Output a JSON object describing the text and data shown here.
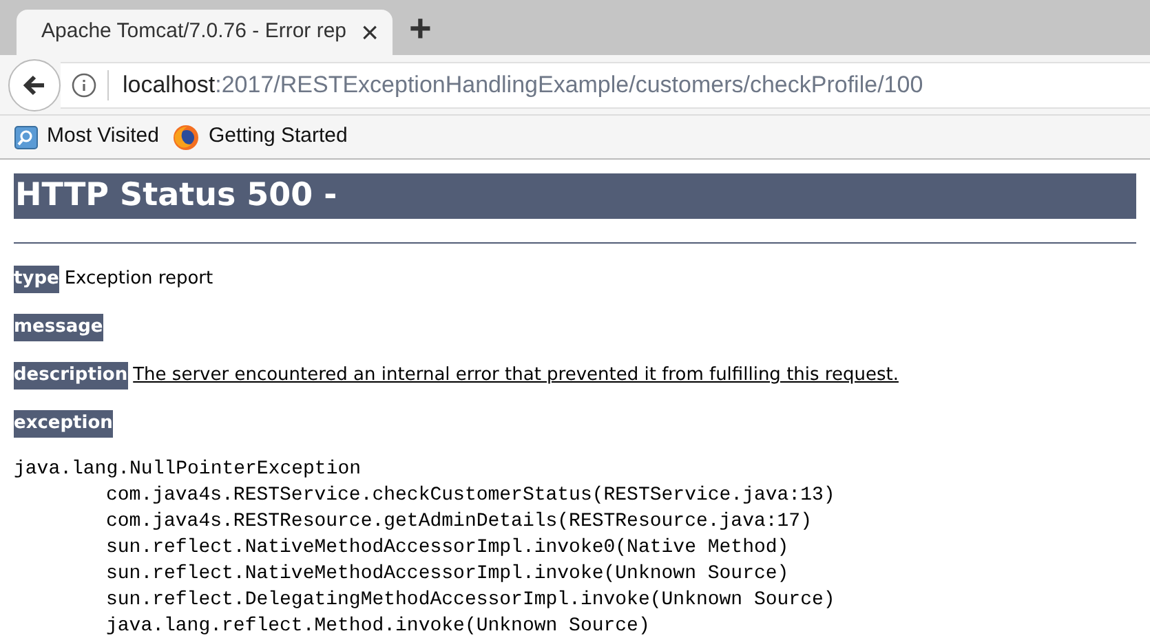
{
  "tab": {
    "title": "Apache Tomcat/7.0.76 - Error rep",
    "close": "×"
  },
  "new_tab": "+",
  "address": {
    "host": "localhost",
    "path": ":2017/RESTExceptionHandlingExample/customers/checkProfile/100"
  },
  "bookmarks": [
    {
      "label": "Most Visited",
      "kind": "folder"
    },
    {
      "label": "Getting Started",
      "kind": "browser"
    }
  ],
  "page": {
    "heading": "HTTP Status 500 -",
    "fields": [
      {
        "label": "type",
        "value": "Exception report",
        "underlined": false
      },
      {
        "label": "message"
      },
      {
        "label": "description",
        "value": "The server encountered an internal error that prevented it from fulfilling this request.",
        "underlined": true
      },
      {
        "label": "exception"
      }
    ],
    "exception": {
      "name": "java.lang.NullPointerException",
      "frames": [
        "com.java4s.RESTService.checkCustomerStatus(RESTService.java:13)",
        "com.java4s.RESTResource.getAdminDetails(RESTResource.java:17)",
        "sun.reflect.NativeMethodAccessorImpl.invoke0(Native Method)",
        "sun.reflect.NativeMethodAccessorImpl.invoke(Unknown Source)",
        "sun.reflect.DelegatingMethodAccessorImpl.invoke(Unknown Source)",
        "java.lang.reflect.Method.invoke(Unknown Source)"
      ]
    }
  }
}
